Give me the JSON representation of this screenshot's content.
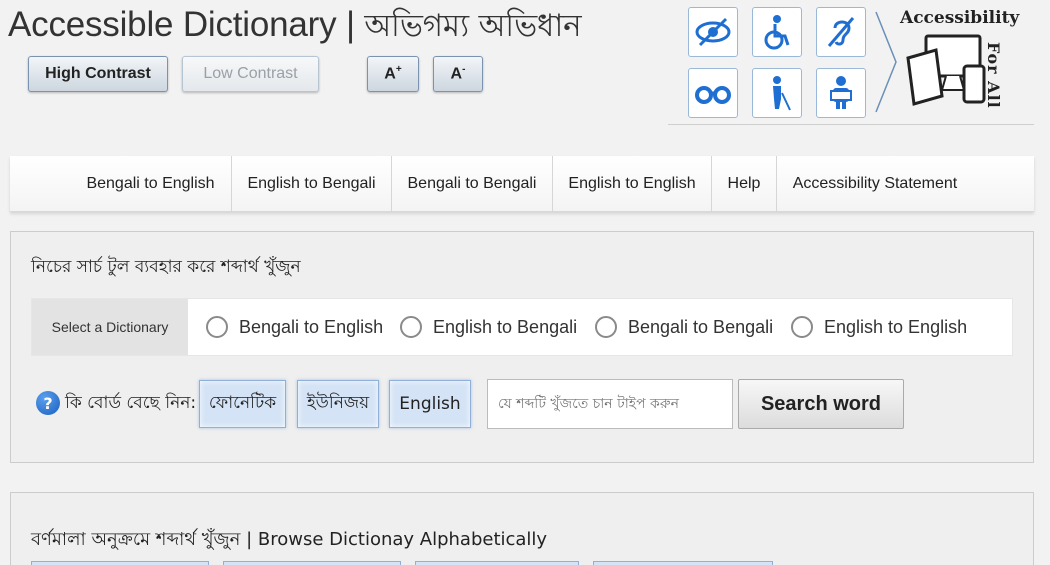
{
  "header": {
    "title_en": "Accessible Dictionary",
    "title_sep": "|",
    "title_bn": "অভিগম্য অভিধান"
  },
  "contrast": {
    "high_label": "High Contrast",
    "low_label": "Low Contrast"
  },
  "font_size": {
    "increase_base": "A",
    "increase_sup": "+",
    "decrease_base": "A",
    "decrease_sup": "-"
  },
  "accessibility_logo": {
    "line1": "Accessibility",
    "line2": "For All",
    "icons": [
      "low-vision-icon",
      "wheelchair-icon",
      "hearing-impaired-icon",
      "glasses-icon",
      "blind-person-cane-icon",
      "cognitive-disability-icon"
    ]
  },
  "nav": {
    "items": [
      {
        "label": "Bengali to English"
      },
      {
        "label": "English to Bengali"
      },
      {
        "label": "Bengali to Bengali"
      },
      {
        "label": "English to English"
      },
      {
        "label": "Help"
      },
      {
        "label": "Accessibility Statement"
      }
    ]
  },
  "search": {
    "heading": "নিচের সার্চ টুল ব্যবহার করে শব্দার্থ খুঁজুন",
    "select_label": "Select a Dictionary",
    "options": [
      {
        "label": "Bengali to English"
      },
      {
        "label": "English to Bengali"
      },
      {
        "label": "Bengali to Bengali"
      },
      {
        "label": "English to English"
      }
    ],
    "keyboard_label": "কি বোর্ড বেছে নিন:",
    "keyboards": [
      {
        "label": "ফোনেটিক"
      },
      {
        "label": "ইউনিজয়"
      },
      {
        "label": "English"
      }
    ],
    "input_placeholder": "যে শব্দটি খুঁজতে চান টাইপ করুন",
    "input_value": "",
    "button_label": "Search word"
  },
  "browse": {
    "heading": "বর্ণমালা অনুক্রমে শব্দার্থ খুঁজুন | Browse Dictionay Alphabetically"
  },
  "colors": {
    "icon_blue": "#1e6fd1",
    "keyboard_bg": "#d4e3f5",
    "page_bg": "#f2f2f2"
  }
}
